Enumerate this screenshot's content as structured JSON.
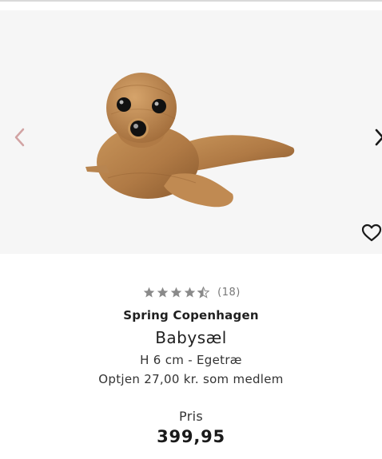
{
  "product": {
    "rating": {
      "value": 4.5,
      "max": 5,
      "count_text": "(18)"
    },
    "brand": "Spring Copenhagen",
    "name": "Babysæl",
    "variant": "H 6 cm - Egetræ",
    "points_text": "Optjen 27,00 kr. som medlem",
    "price_label": "Pris",
    "price": "399,95"
  },
  "icons": {
    "prev": "chevron-left-icon",
    "next": "chevron-right-icon",
    "wishlist": "heart-icon",
    "star": "star-icon"
  },
  "colors": {
    "star_fill": "#8a8a8a",
    "gallery_bg": "#f6f6f6",
    "wood": "#b07a45"
  }
}
